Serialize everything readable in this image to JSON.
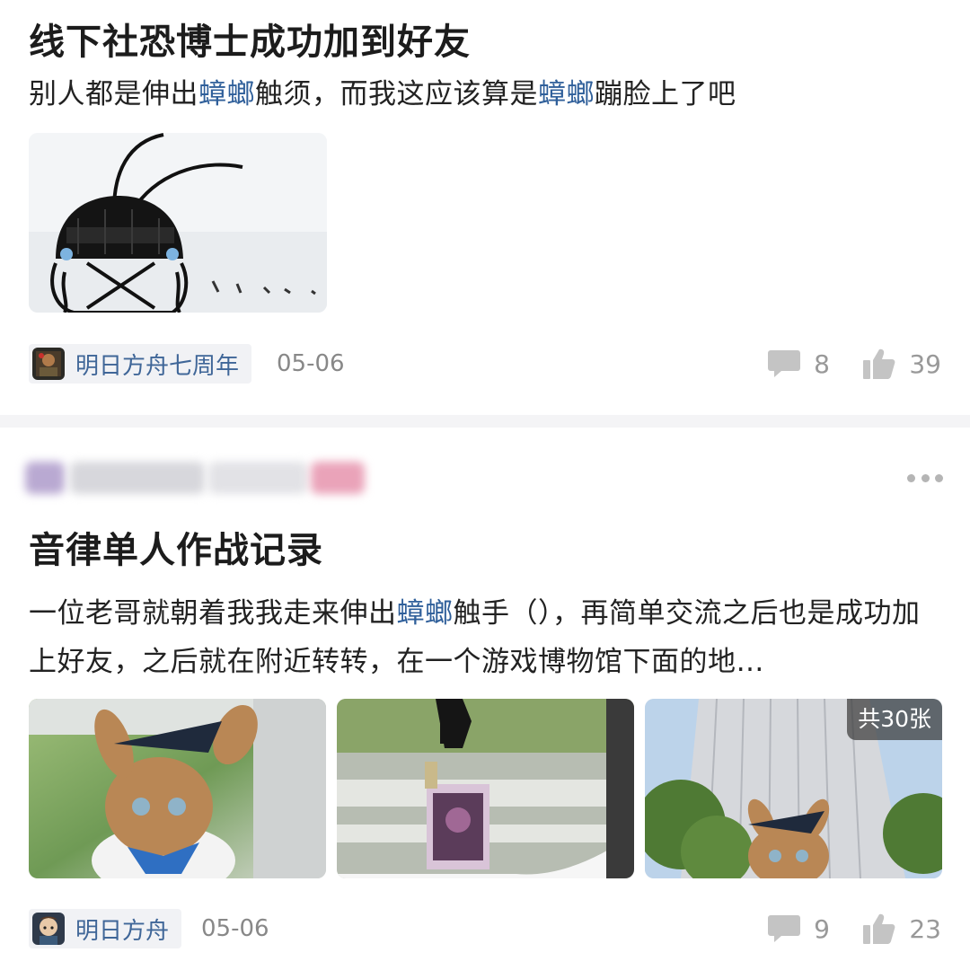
{
  "posts": [
    {
      "title": "线下社恐博士成功加到好友",
      "body": {
        "p1": "别人都是伸出",
        "hl1": "蟑螂",
        "p2": "触须，而我这应该算是",
        "hl2": "蟑螂",
        "p3": "蹦脸上了吧"
      },
      "images": [
        {
          "icon": "cockroach-doodle-image"
        }
      ],
      "tag": {
        "label": "明日方舟七周年",
        "icon": "arknights-7th-anniversary-avatar"
      },
      "date": "05-06",
      "comments": "8",
      "likes": "39"
    },
    {
      "author_blurred": true,
      "title": "音律单人作战记录",
      "body": {
        "p1": "一位老哥就朝着我我走来伸出",
        "hl1": "蟑螂",
        "p2": "触手（），再简单交流之后也是成功加上好友，之后就在附近转转，在一个游戏博物馆下面的地…"
      },
      "images": [
        {
          "icon": "plush-on-train-window-photo"
        },
        {
          "icon": "keychain-badge-photo"
        },
        {
          "icon": "skyscraper-plush-photo"
        }
      ],
      "image_count_badge": "共30张",
      "tag": {
        "label": "明日方舟",
        "icon": "arknights-avatar"
      },
      "date": "05-06",
      "comments": "9",
      "likes": "23"
    }
  ],
  "colors": {
    "highlight": "#2f5f9a",
    "tag_text": "#3f6698",
    "tag_bg": "#f1f2f5",
    "meta_gray": "#999999",
    "divider": "#f4f4f6"
  }
}
